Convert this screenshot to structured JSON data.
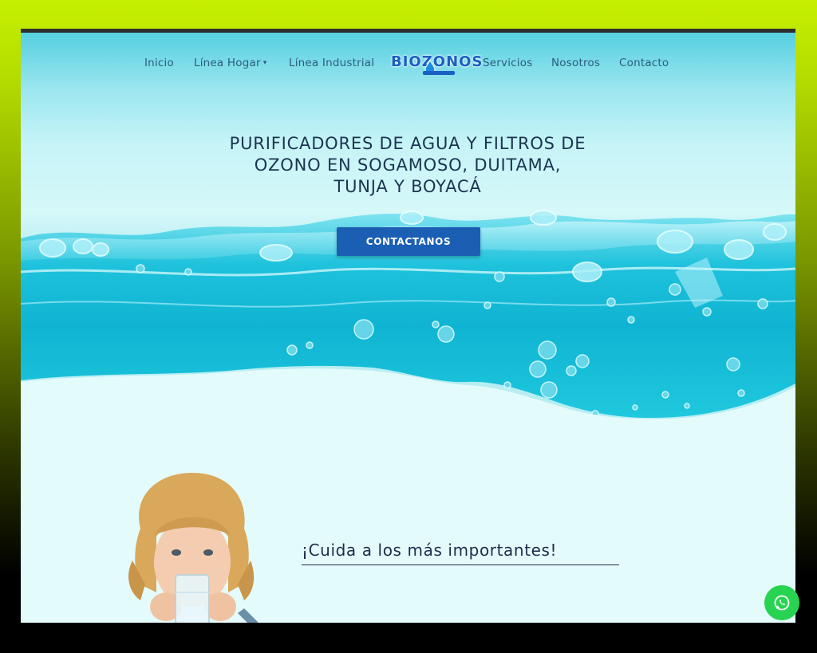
{
  "nav": {
    "items": [
      {
        "label": "Inicio"
      },
      {
        "label": "Línea Hogar",
        "caret": "▾"
      },
      {
        "label": "Línea Industrial"
      },
      {
        "label": "Servicios"
      },
      {
        "label": "Nosotros"
      },
      {
        "label": "Contacto"
      }
    ],
    "logo_text": "BIOZONOS"
  },
  "hero": {
    "headline_line1": "PURIFICADORES DE AGUA Y FILTROS DE",
    "headline_line2": "OZONO EN SOGAMOSO, DUITAMA,",
    "headline_line3": "TUNJA Y BOYACÁ",
    "cta_label": "CONTACTANOS"
  },
  "section": {
    "tagline": "¡Cuida a los más importantes!"
  },
  "icons": {
    "whatsapp": "whatsapp-icon",
    "logo_drop": "water-drop-icon"
  },
  "colors": {
    "accent": "#1b5fb5",
    "whatsapp": "#29d352",
    "text_dark": "#1b3550",
    "frame_lime": "#c6f000"
  }
}
